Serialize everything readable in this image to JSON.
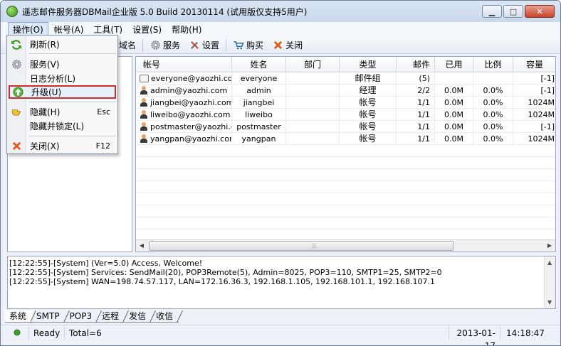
{
  "window": {
    "title": "遥志邮件服务器DBMail企业版 5.0 Build 20130114 (试用版仅支持5用户)",
    "buttons": {
      "minimize": "▁",
      "maximize": "□",
      "close": "✕"
    }
  },
  "menubar": [
    {
      "label": "操作(O)",
      "active": true
    },
    {
      "label": "帐号(A)"
    },
    {
      "label": "工具(T)"
    },
    {
      "label": "设置(S)"
    },
    {
      "label": "帮助(H)"
    }
  ],
  "toolbar": {
    "domain": "域名",
    "service": "服务",
    "settings": "设置",
    "buy": "购买",
    "close": "关闭"
  },
  "dropdown": {
    "items": [
      {
        "label": "刷新(R)",
        "icon": "refresh-icon",
        "shortcut": ""
      },
      {
        "label": "服务(V)",
        "icon": "gear-icon",
        "shortcut": ""
      },
      {
        "label": "日志分析(L)",
        "icon": "",
        "shortcut": ""
      },
      {
        "label": "升级(U)",
        "icon": "up-arrow-icon",
        "shortcut": ""
      },
      {
        "label": "隐藏(H)",
        "icon": "hand-icon",
        "shortcut": "Esc"
      },
      {
        "label": "隐藏并锁定(L)",
        "icon": "",
        "shortcut": ""
      },
      {
        "label": "关闭(X)",
        "icon": "close-x-icon",
        "shortcut": "F12"
      }
    ]
  },
  "grid": {
    "columns": [
      "帐号",
      "姓名",
      "部门",
      "类型",
      "邮件",
      "已用",
      "比例",
      "容量"
    ],
    "rows": [
      {
        "type_icon": "group",
        "account": "everyone@yaozhi.com",
        "name": "everyone",
        "dept": "",
        "kind": "邮件组",
        "mail": "(5)",
        "used": "",
        "ratio": "",
        "capacity": "[-1]"
      },
      {
        "type_icon": "user",
        "account": "admin@yaozhi.com",
        "name": "admin",
        "dept": "",
        "kind": "经理",
        "mail": "2/2",
        "used": "0.0M",
        "ratio": "0.0%",
        "capacity": "[-1]"
      },
      {
        "type_icon": "user",
        "account": "jiangbei@yaozhi.com",
        "name": "jiangbei",
        "dept": "",
        "kind": "帐号",
        "mail": "1/1",
        "used": "0.0M",
        "ratio": "0.0%",
        "capacity": "1024M"
      },
      {
        "type_icon": "user",
        "account": "liweibo@yaozhi.com",
        "name": "liweibo",
        "dept": "",
        "kind": "帐号",
        "mail": "1/1",
        "used": "0.0M",
        "ratio": "0.0%",
        "capacity": "1024M"
      },
      {
        "type_icon": "user",
        "account": "postmaster@yaozhi.c...",
        "name": "postmaster",
        "dept": "",
        "kind": "帐号",
        "mail": "1/1",
        "used": "0.0M",
        "ratio": "0.0%",
        "capacity": "[-1]"
      },
      {
        "type_icon": "user",
        "account": "yangpan@yaozhi.com",
        "name": "yangpan",
        "dept": "",
        "kind": "帐号",
        "mail": "1/1",
        "used": "0.0M",
        "ratio": "0.0%",
        "capacity": "1024M"
      }
    ]
  },
  "log": [
    "[12:22:55]-[System] (Ver=5.0) Access, Welcome!",
    "[12:22:55]-[System] Services: SendMail(20), POP3Remote(5), Admin=8025, POP3=110, SMTP1=25, SMTP2=0",
    "[12:22:55]-[System] WAN=198.74.57.117, LAN=172.16.36.3, 192.168.1.105, 192.168.101.1, 192.168.107.1"
  ],
  "tabs": [
    "系统",
    "SMTP",
    "POP3",
    "远程",
    "发信",
    "收信"
  ],
  "status": {
    "ready": "Ready",
    "total": "Total=6",
    "date": "2013-01-17",
    "time": "14:18:47"
  },
  "colors": {
    "highlight_border": "#d22a2a",
    "title_bg": "#c9d8ec"
  }
}
